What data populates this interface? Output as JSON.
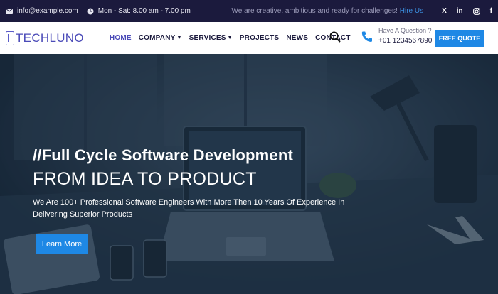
{
  "topbar": {
    "email": "info@example.com",
    "hours": "Mon - Sat: 8.00 am - 7.00 pm",
    "tagline": "We are creative, ambitious and ready for challenges!",
    "hire_link": "Hire Us",
    "social": {
      "x": "X",
      "linkedin": "in",
      "facebook": "f"
    }
  },
  "nav": {
    "logo_text": "TECHLUNO",
    "items": [
      {
        "label": "HOME",
        "active": true
      },
      {
        "label": "COMPANY",
        "dropdown": true
      },
      {
        "label": "SERVICES",
        "dropdown": true
      },
      {
        "label": "PROJECTS"
      },
      {
        "label": "NEWS"
      },
      {
        "label": "CONTACT"
      }
    ],
    "contact_question": "Have A Question ?",
    "phone": "+01 1234567890",
    "quote_button": "FREE QUOTE"
  },
  "hero": {
    "title_line1": "//Full Cycle Software Development",
    "title_line2": "FROM IDEA TO PRODUCT",
    "description": "We Are 100+ Professional Software Engineers With More Then 10 Years Of Experience In Delivering Superior Products",
    "cta": "Learn More"
  },
  "colors": {
    "topbar_bg": "#1b1a3d",
    "accent": "#1e88e5",
    "brand": "#4b4bb8"
  }
}
